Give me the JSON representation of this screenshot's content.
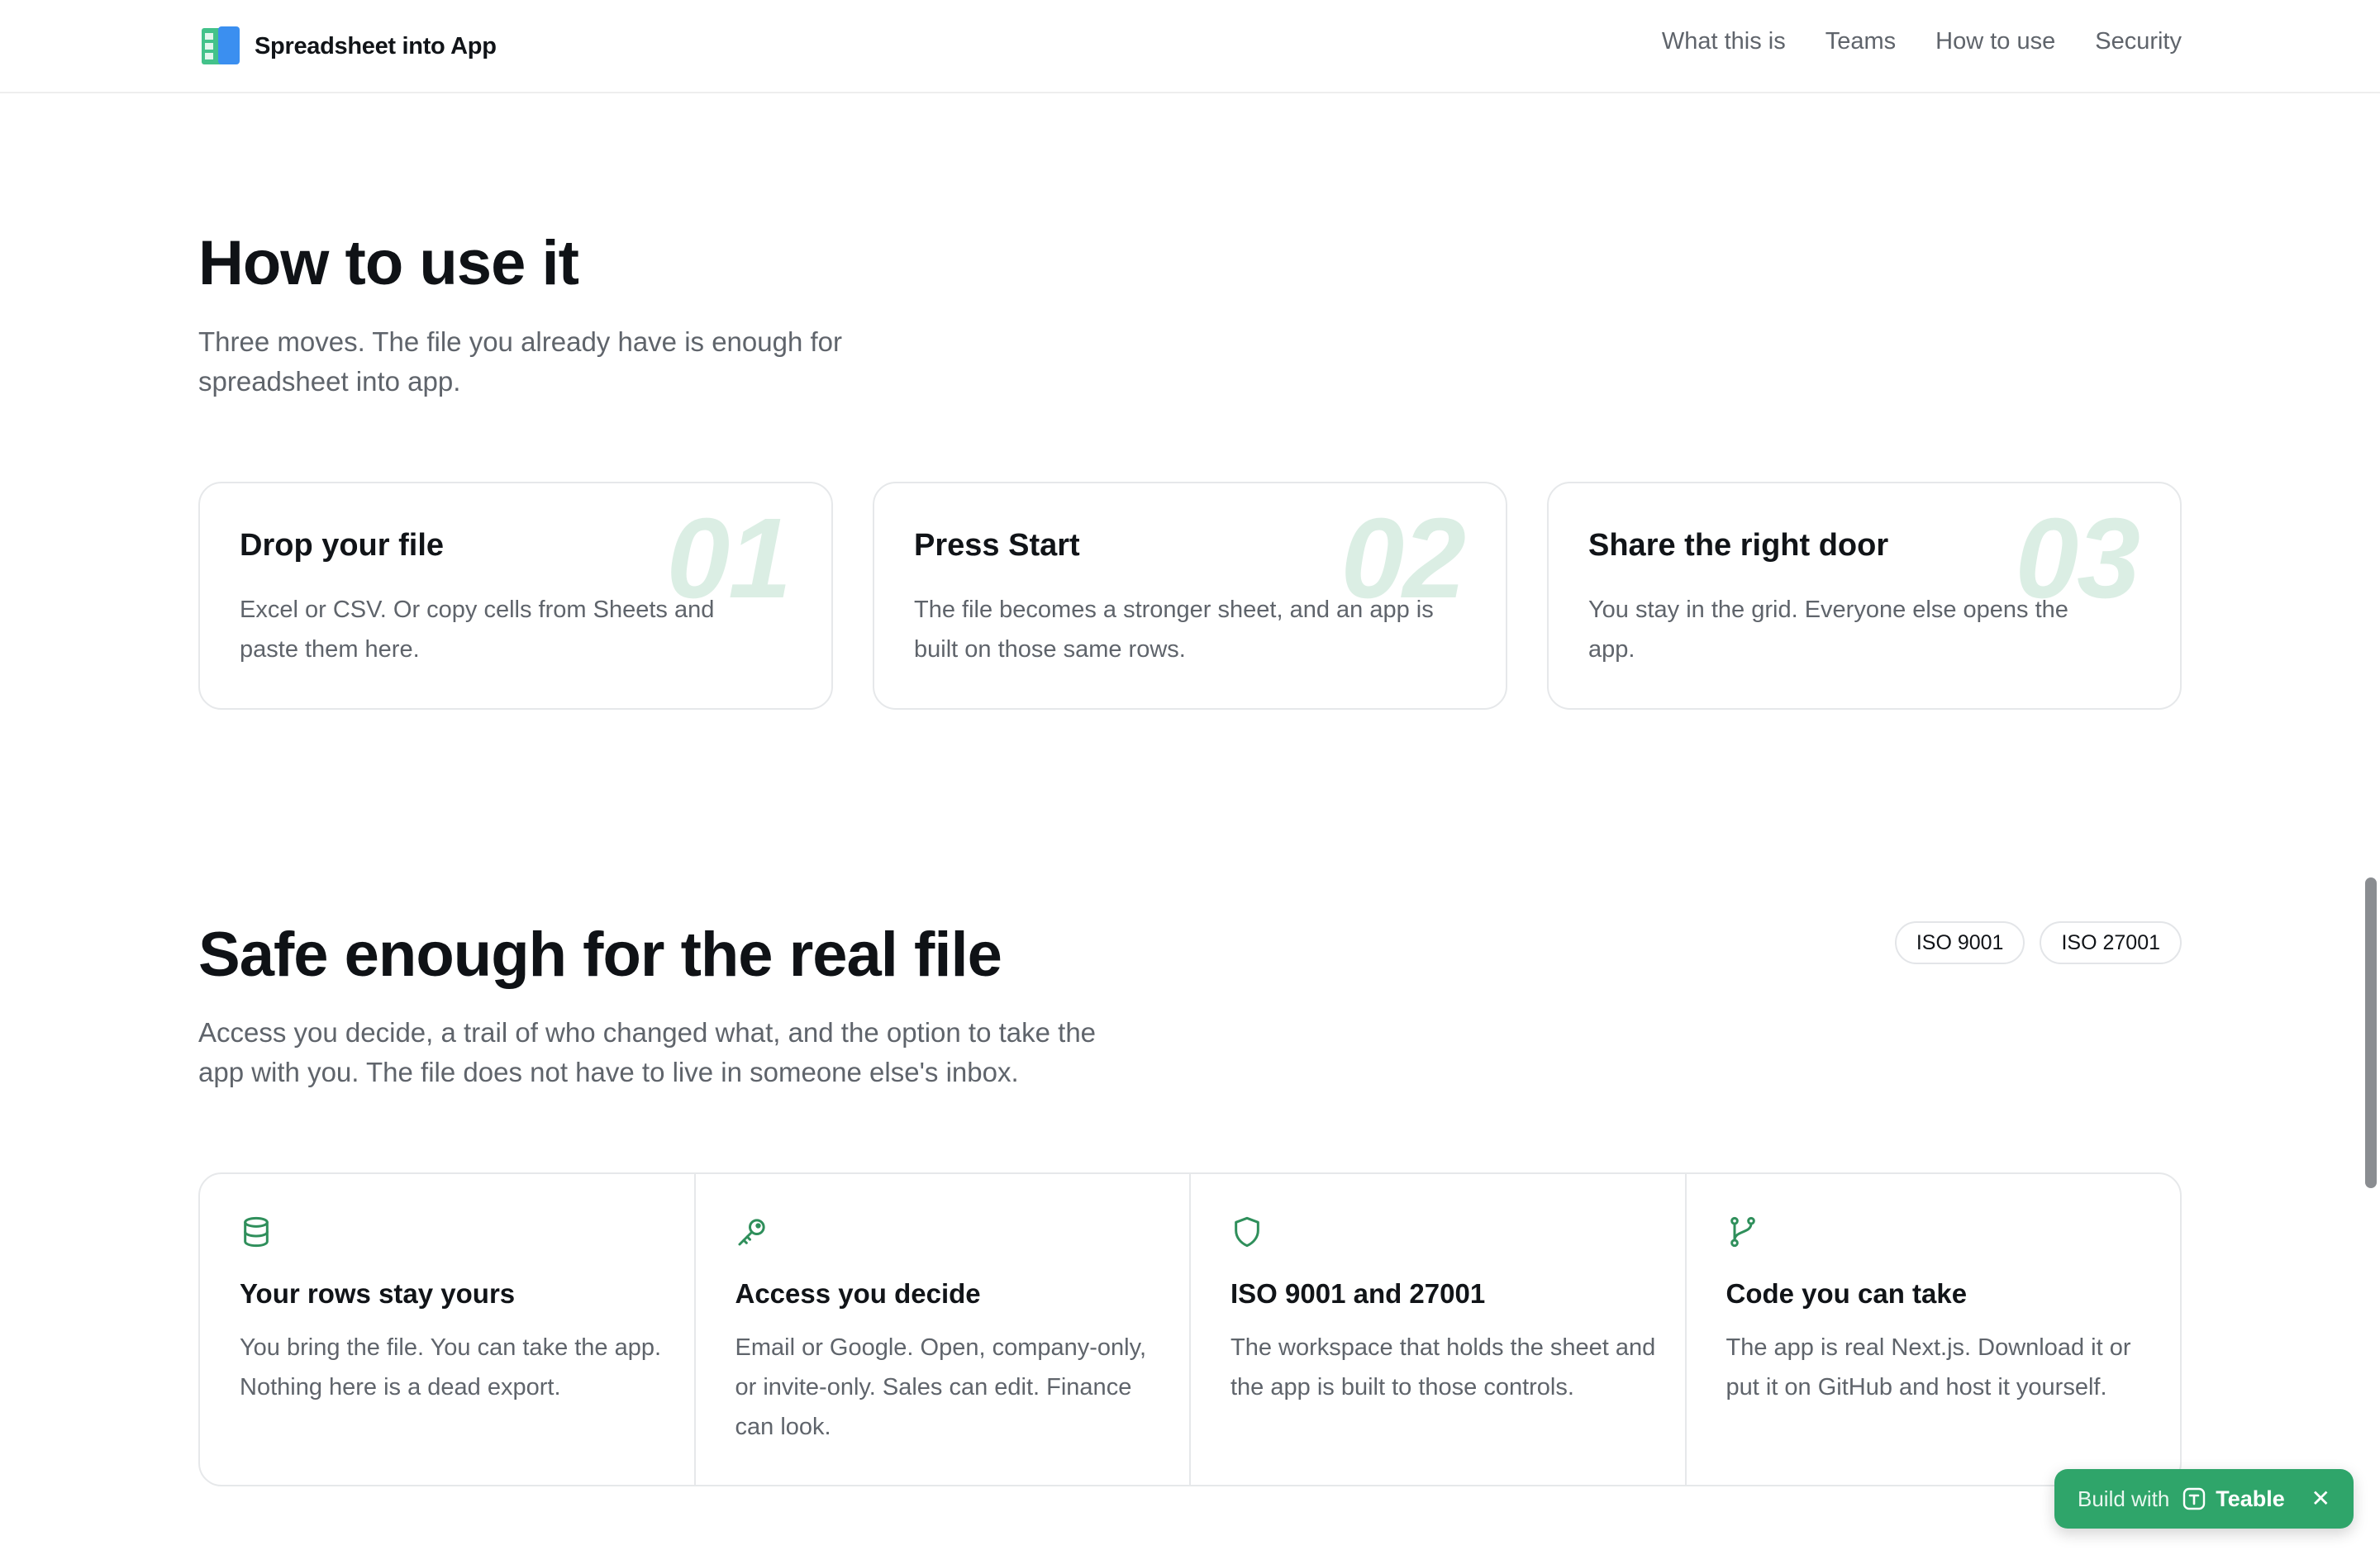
{
  "header": {
    "brand_name": "Spreadsheet into App",
    "nav": [
      {
        "label": "What this is"
      },
      {
        "label": "Teams"
      },
      {
        "label": "How to use"
      },
      {
        "label": "Security"
      }
    ]
  },
  "how_to_use": {
    "title": "How to use it",
    "subtitle_line1": "Three moves. The file you already have is enough for",
    "subtitle_line2": "spreadsheet into app.",
    "steps": [
      {
        "num": "01",
        "title": "Drop your file",
        "desc": "Excel or CSV. Or copy cells from Sheets and paste them here."
      },
      {
        "num": "02",
        "title": "Press Start",
        "desc": "The file becomes a stronger sheet, and an app is built on those same rows."
      },
      {
        "num": "03",
        "title": "Share the right door",
        "desc": "You stay in the grid. Everyone else opens the app."
      }
    ]
  },
  "security": {
    "title": "Safe enough for the real file",
    "subtitle_line1": "Access you decide, a trail of who changed what, and the option to take the",
    "subtitle_line2": "app with you. The file does not have to live in someone else's inbox.",
    "badges": [
      "ISO 9001",
      "ISO 27001"
    ],
    "features": [
      {
        "icon": "database-icon",
        "title": "Your rows stay yours",
        "desc": "You bring the file. You can take the app. Nothing here is a dead export."
      },
      {
        "icon": "key-icon",
        "title": "Access you decide",
        "desc": "Email or Google. Open, company-only, or invite-only. Sales can edit. Finance can look."
      },
      {
        "icon": "shield-icon",
        "title": "ISO 9001 and 27001",
        "desc": "The workspace that holds the sheet and the app is built to those controls."
      },
      {
        "icon": "git-branch-icon",
        "title": "Code you can take",
        "desc": "The app is real Next.js. Download it or put it on GitHub and host it yourself."
      }
    ]
  },
  "build_pill": {
    "prefix": "Build with",
    "brand": "Teable",
    "close": "✕"
  },
  "colors": {
    "accent": "#2fa56a",
    "icon_green": "#2f8f5b",
    "step_number": "#dbeee4",
    "muted_text": "#5f646b"
  }
}
